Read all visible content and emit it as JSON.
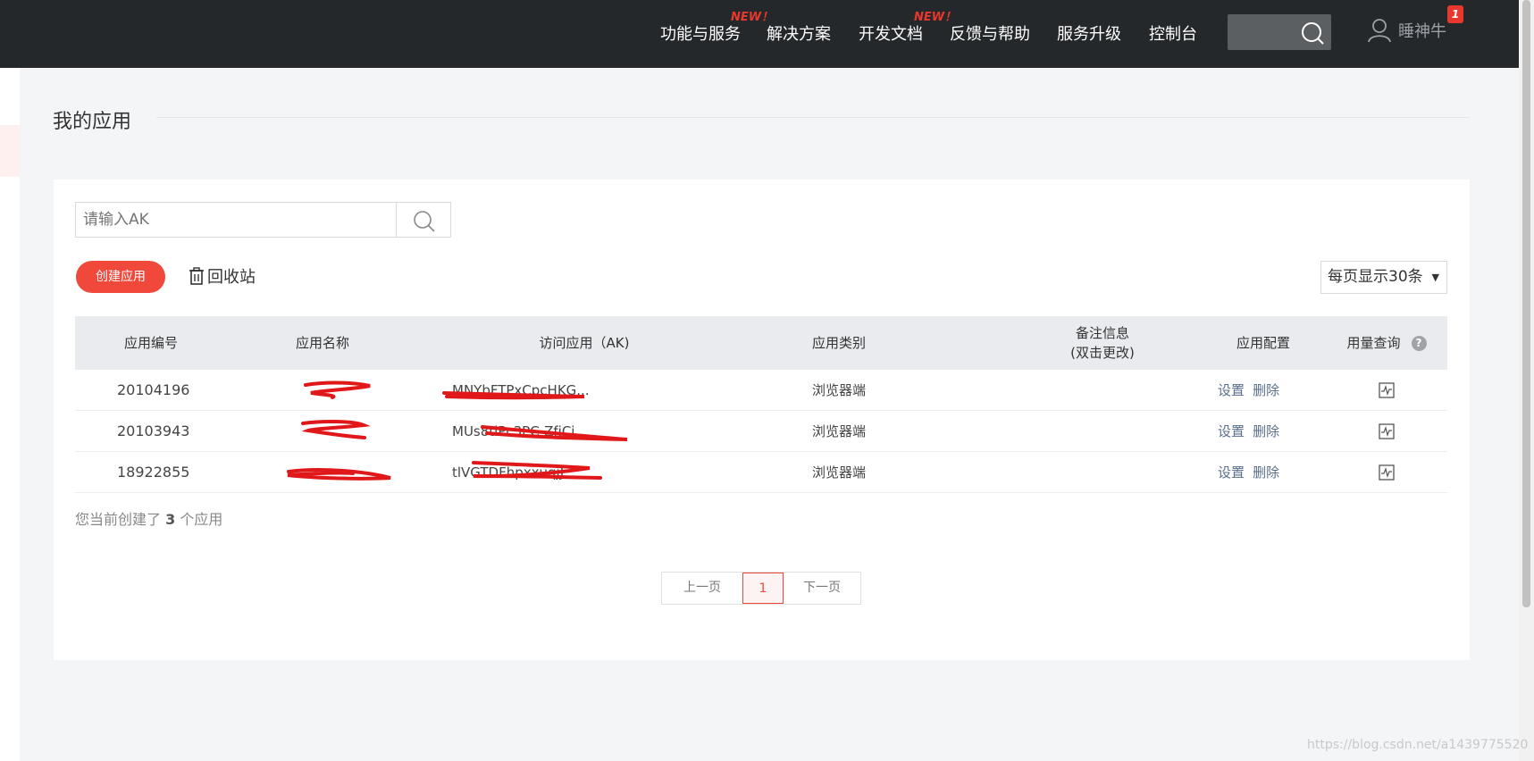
{
  "nav": {
    "items": [
      "功能与服务",
      "解决方案",
      "开发文档",
      "反馈与帮助",
      "服务升级",
      "控制台"
    ],
    "new_badge_1": "NEW！",
    "new_badge_2": "NEW！",
    "user_name": "睡神牛",
    "notification_count": "1"
  },
  "page": {
    "title": "我的应用"
  },
  "search": {
    "placeholder": "请输入AK"
  },
  "toolbar": {
    "create_label": "创建应用",
    "recycle_label": "回收站",
    "per_page_label": "每页显示30条"
  },
  "table": {
    "headers": {
      "app_id": "应用编号",
      "app_name": "应用名称",
      "ak": "访问应用（AK)",
      "type": "应用类别",
      "remark_line1": "备注信息",
      "remark_line2": "(双击更改)",
      "config": "应用配置",
      "usage": "用量查询"
    },
    "rows": [
      {
        "id": "20104196",
        "ak": "MNYbFTPxCpcHKG...",
        "type": "浏览器端",
        "settings": "设置",
        "delete": "删除"
      },
      {
        "id": "20103943",
        "ak": "MUs8tiPc3PC-ZfjCi",
        "type": "浏览器端",
        "settings": "设置",
        "delete": "删除"
      },
      {
        "id": "18922855",
        "ak": "tlVGTDFhpxxuqjJ",
        "type": "浏览器端",
        "settings": "设置",
        "delete": "删除"
      }
    ]
  },
  "summary": {
    "prefix": "您当前创建了",
    "count": "3",
    "suffix": "个应用"
  },
  "pagination": {
    "prev": "上一页",
    "current": "1",
    "next": "下一页"
  },
  "watermark": "https://blog.csdn.net/a1439775520",
  "colors": {
    "accent": "#f0493c",
    "navbar": "#24282b",
    "scribble": "#e0181a"
  }
}
